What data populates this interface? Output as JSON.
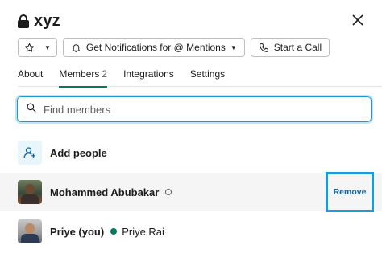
{
  "channel": {
    "name": "xyz"
  },
  "toolbar": {
    "notifications_label": "Get Notifications for @ Mentions",
    "call_label": "Start a Call"
  },
  "tabs": [
    {
      "label": "About"
    },
    {
      "label": "Members",
      "count": "2"
    },
    {
      "label": "Integrations"
    },
    {
      "label": "Settings"
    }
  ],
  "search": {
    "placeholder": "Find members",
    "value": ""
  },
  "add_people": {
    "label": "Add people"
  },
  "members": [
    {
      "name": "Mohammed Abubakar",
      "status": "away",
      "action": "Remove"
    },
    {
      "name": "Priye (you)",
      "status": "active",
      "display_name": "Priye Rai"
    }
  ],
  "colors": {
    "accent": "#007a5a",
    "highlight": "#1c9bd6",
    "link": "#1264a3"
  },
  "icons": [
    "lock-icon",
    "close-icon",
    "star-icon",
    "bell-icon",
    "phone-icon",
    "search-icon",
    "add-person-icon"
  ]
}
